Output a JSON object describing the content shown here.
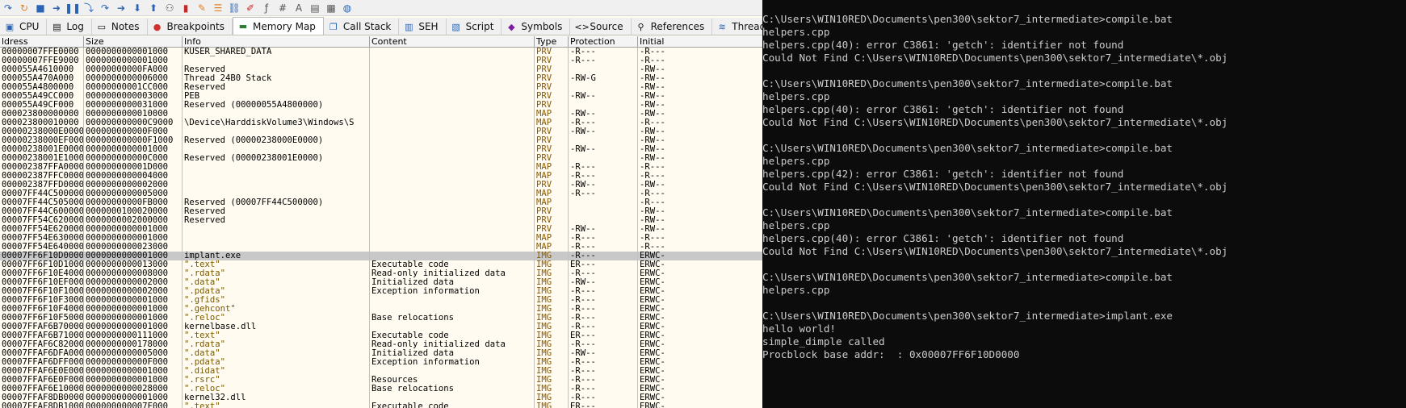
{
  "debugger": {
    "tabs": [
      {
        "label": "CPU",
        "icon": "cpu-icon"
      },
      {
        "label": "Log",
        "icon": "log-icon"
      },
      {
        "label": "Notes",
        "icon": "notes-icon"
      },
      {
        "label": "Breakpoints",
        "icon": "breakpoint-icon"
      },
      {
        "label": "Memory Map",
        "icon": "memory-map-icon"
      },
      {
        "label": "Call Stack",
        "icon": "call-stack-icon"
      },
      {
        "label": "SEH",
        "icon": "seh-icon"
      },
      {
        "label": "Script",
        "icon": "script-icon"
      },
      {
        "label": "Symbols",
        "icon": "symbols-icon"
      },
      {
        "label": "Source",
        "icon": "source-icon"
      },
      {
        "label": "References",
        "icon": "references-icon"
      },
      {
        "label": "Threads",
        "icon": "threads-icon"
      }
    ],
    "active_tab": "Memory Map",
    "columns": [
      "ldress",
      "Size",
      "Info",
      "Content",
      "Type",
      "Protection",
      "Initial"
    ],
    "rows": [
      [
        "00000007FFE0000",
        "0000000000001000",
        "KUSER_SHARED_DATA",
        "",
        "PRV",
        "-R---",
        "-R---"
      ],
      [
        "00000007FFE9000",
        "0000000000001000",
        "",
        "",
        "PRV",
        "-R---",
        "-R---"
      ],
      [
        "000055A4610000",
        "00000000000FA000",
        "Reserved",
        "",
        "PRV",
        "",
        "-RW--"
      ],
      [
        "000055A470A000",
        "0000000000006000",
        "Thread 24B0 Stack",
        "",
        "PRV",
        "-RW-G",
        "-RW--"
      ],
      [
        "000055A4800000",
        "00000000001CC000",
        "Reserved",
        "",
        "PRV",
        "",
        "-RW--"
      ],
      [
        "000055A49CC000",
        "0000000000003000",
        "PEB",
        "",
        "PRV",
        "-RW--",
        "-RW--"
      ],
      [
        "000055A49CF000",
        "0000000000031000",
        "Reserved (00000055A4800000)",
        "",
        "PRV",
        "",
        "-RW--"
      ],
      [
        "000023800000000",
        "0000000000010000",
        "",
        "",
        "MAP",
        "-RW--",
        "-RW--"
      ],
      [
        "000023800010000",
        "000000000000C9000",
        "\\Device\\HarddiskVolume3\\Windows\\S",
        "",
        "MAP",
        "-R---",
        "-R---"
      ],
      [
        "00000238000E0000",
        "000000000000F000",
        "",
        "",
        "PRV",
        "-RW--",
        "-RW--"
      ],
      [
        "00000238000EF000",
        "000000000000F1000",
        "Reserved (00000238000E0000)",
        "",
        "PRV",
        "",
        "-RW--"
      ],
      [
        "00000238001E0000",
        "0000000000001000",
        "",
        "",
        "PRV",
        "-RW--",
        "-RW--"
      ],
      [
        "00000238001E1000",
        "000000000000C000",
        "Reserved (00000238001E0000)",
        "",
        "PRV",
        "",
        "-RW--"
      ],
      [
        "000002387FFA0000",
        "000000000001D000",
        "",
        "",
        "MAP",
        "-R---",
        "-R---"
      ],
      [
        "000002387FFC0000",
        "0000000000004000",
        "",
        "",
        "MAP",
        "-R---",
        "-R---"
      ],
      [
        "000002387FFD0000",
        "0000000000002000",
        "",
        "",
        "PRV",
        "-RW--",
        "-RW--"
      ],
      [
        "00007FF44C500000",
        "0000000000005000",
        "",
        "",
        "MAP",
        "-R---",
        "-R---"
      ],
      [
        "00007FF44C505000",
        "00000000000FB000",
        "Reserved (00007FF44C500000)",
        "",
        "MAP",
        "",
        "-R---"
      ],
      [
        "00007FF44C600000",
        "0000000100020000",
        "Reserved",
        "",
        "PRV",
        "",
        "-RW--"
      ],
      [
        "00007FF54C620000",
        "0000000002000000",
        "Reserved",
        "",
        "PRV",
        "",
        "-RW--"
      ],
      [
        "00007FF54E620000",
        "0000000000001000",
        "",
        "",
        "PRV",
        "-RW--",
        "-RW--"
      ],
      [
        "00007FF54E630000",
        "0000000000001000",
        "",
        "",
        "MAP",
        "-R---",
        "-R---"
      ],
      [
        "00007FF54E640000",
        "0000000000023000",
        "",
        "",
        "MAP",
        "-R---",
        "-R---"
      ],
      [
        "00007FF6F10D0000",
        "0000000000001000",
        "implant.exe",
        "",
        "IMG",
        "-R---",
        "ERWC-"
      ],
      [
        "00007FF6F10D1000",
        "0000000000013000",
        "\".text\"",
        "Executable code",
        "IMG",
        "ER---",
        "ERWC-"
      ],
      [
        "00007FF6F10E4000",
        "0000000000008000",
        "\".rdata\"",
        "Read-only initialized data",
        "IMG",
        "-R---",
        "ERWC-"
      ],
      [
        "00007FF6F10EF000",
        "0000000000002000",
        "\".data\"",
        "Initialized data",
        "IMG",
        "-RW--",
        "ERWC-"
      ],
      [
        "00007FF6F10F1000",
        "0000000000002000",
        "\".pdata\"",
        "Exception information",
        "IMG",
        "-R---",
        "ERWC-"
      ],
      [
        "00007FF6F10F3000",
        "0000000000001000",
        "\".gfids\"",
        "",
        "IMG",
        "-R---",
        "ERWC-"
      ],
      [
        "00007FF6F10F4000",
        "0000000000001000",
        "\".gehcont\"",
        "",
        "IMG",
        "-R---",
        "ERWC-"
      ],
      [
        "00007FF6F10F5000",
        "0000000000001000",
        "\".reloc\"",
        "Base relocations",
        "IMG",
        "-R---",
        "ERWC-"
      ],
      [
        "00007FFAF6B70000",
        "0000000000001000",
        "kernelbase.dll",
        "",
        "IMG",
        "-R---",
        "ERWC-"
      ],
      [
        "00007FFAF6B71000",
        "0000000000111000",
        "\".text\"",
        "Executable code",
        "IMG",
        "ER---",
        "ERWC-"
      ],
      [
        "00007FFAF6C82000",
        "0000000000178000",
        "\".rdata\"",
        "Read-only initialized data",
        "IMG",
        "-R---",
        "ERWC-"
      ],
      [
        "00007FFAF6DFA000",
        "0000000000005000",
        "\".data\"",
        "Initialized data",
        "IMG",
        "-RW--",
        "ERWC-"
      ],
      [
        "00007FFAF6DFF000",
        "000000000000F000",
        "\".pdata\"",
        "Exception information",
        "IMG",
        "-R---",
        "ERWC-"
      ],
      [
        "00007FFAF6E0E000",
        "0000000000001000",
        "\".didat\"",
        "",
        "IMG",
        "-R---",
        "ERWC-"
      ],
      [
        "00007FFAF6E0F000",
        "0000000000001000",
        "\".rsrc\"",
        "Resources",
        "IMG",
        "-R---",
        "ERWC-"
      ],
      [
        "00007FFAF6E10000",
        "0000000000028000",
        "\".reloc\"",
        "Base relocations",
        "IMG",
        "-R---",
        "ERWC-"
      ],
      [
        "00007FFAF8DB0000",
        "0000000000001000",
        "kernel32.dll",
        "",
        "IMG",
        "-R---",
        "ERWC-"
      ],
      [
        "00007FFAF8DB1000",
        "000000000007F000",
        "\".text\"",
        "Executable code",
        "IMG",
        "ER---",
        "ERWC-"
      ]
    ],
    "selected_row": 23
  },
  "console": {
    "lines": [
      "C:\\Users\\WIN10RED\\Documents\\pen300\\sektor7_intermediate>compile.bat",
      "helpers.cpp",
      "helpers.cpp(40): error C3861: 'getch': identifier not found",
      "Could Not Find C:\\Users\\WIN10RED\\Documents\\pen300\\sektor7_intermediate\\*.obj",
      "",
      "C:\\Users\\WIN10RED\\Documents\\pen300\\sektor7_intermediate>compile.bat",
      "helpers.cpp",
      "helpers.cpp(40): error C3861: 'getch': identifier not found",
      "Could Not Find C:\\Users\\WIN10RED\\Documents\\pen300\\sektor7_intermediate\\*.obj",
      "",
      "C:\\Users\\WIN10RED\\Documents\\pen300\\sektor7_intermediate>compile.bat",
      "helpers.cpp",
      "helpers.cpp(42): error C3861: 'getch': identifier not found",
      "Could Not Find C:\\Users\\WIN10RED\\Documents\\pen300\\sektor7_intermediate\\*.obj",
      "",
      "C:\\Users\\WIN10RED\\Documents\\pen300\\sektor7_intermediate>compile.bat",
      "helpers.cpp",
      "helpers.cpp(40): error C3861: 'getch': identifier not found",
      "Could Not Find C:\\Users\\WIN10RED\\Documents\\pen300\\sektor7_intermediate\\*.obj",
      "",
      "C:\\Users\\WIN10RED\\Documents\\pen300\\sektor7_intermediate>compile.bat",
      "helpers.cpp",
      "",
      "C:\\Users\\WIN10RED\\Documents\\pen300\\sektor7_intermediate>implant.exe",
      "hello world!",
      "simple_dimple called",
      "Procblock base addr:  : 0x00007FF6F10D0000"
    ]
  }
}
